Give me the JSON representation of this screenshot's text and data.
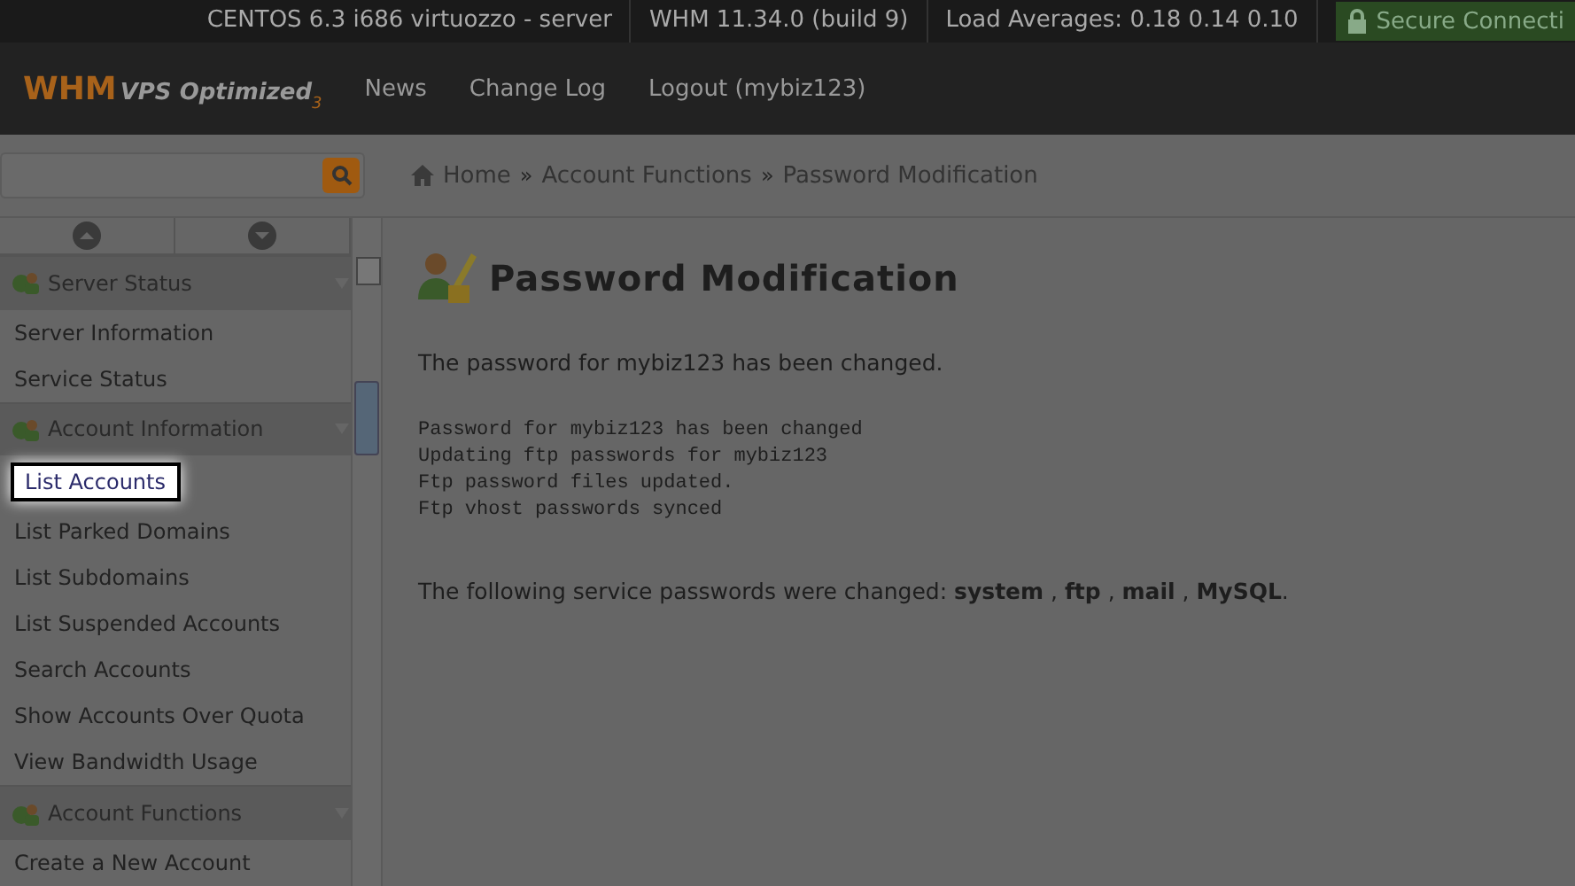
{
  "top_bar": {
    "items": [
      "CENTOS 6.3 i686 virtuozzo - server",
      "WHM 11.34.0 (build 9)",
      "Load Averages: 0.18 0.14 0.10"
    ],
    "secure": "Secure Connecti"
  },
  "header": {
    "logo": {
      "brand": "WHM",
      "product": "VPS Optimized",
      "version": "3"
    },
    "nav": [
      "News",
      "Change Log",
      "Logout (mybiz123)"
    ]
  },
  "breadcrumb": [
    {
      "kind": "link",
      "label": "Home"
    },
    {
      "kind": "separator",
      "label": "»"
    },
    {
      "kind": "link",
      "label": "Account Functions"
    },
    {
      "kind": "separator",
      "label": "»"
    },
    {
      "kind": "link",
      "label": "Password Modification"
    }
  ],
  "sidebar": {
    "items": [
      {
        "kind": "section",
        "label": "Server Status"
      },
      {
        "kind": "link",
        "label": "Server Information",
        "selected": false
      },
      {
        "kind": "link",
        "label": "Service Status",
        "selected": false
      },
      {
        "kind": "section",
        "label": "Account Information"
      },
      {
        "kind": "link",
        "label": "List Accounts",
        "selected": true
      },
      {
        "kind": "link",
        "label": "List Parked Domains",
        "selected": false
      },
      {
        "kind": "link",
        "label": "List Subdomains",
        "selected": false
      },
      {
        "kind": "link",
        "label": "List Suspended Accounts",
        "selected": false
      },
      {
        "kind": "link",
        "label": "Search Accounts",
        "selected": false
      },
      {
        "kind": "link",
        "label": "Show Accounts Over Quota",
        "selected": false
      },
      {
        "kind": "link",
        "label": "View Bandwidth Usage",
        "selected": false
      },
      {
        "kind": "section",
        "label": "Account Functions"
      },
      {
        "kind": "link",
        "label": "Create a New Account",
        "selected": false
      }
    ]
  },
  "content": {
    "title": "Password Modification",
    "message": "The password for mybiz123 has been changed.",
    "log": [
      "Password for mybiz123 has been changed",
      "Updating ftp passwords for mybiz123",
      "Ftp password files updated.",
      "Ftp vhost passwords synced"
    ],
    "summary": "The following service passwords were changed: **system** , **ftp** , **mail** , **MySQL**."
  }
}
